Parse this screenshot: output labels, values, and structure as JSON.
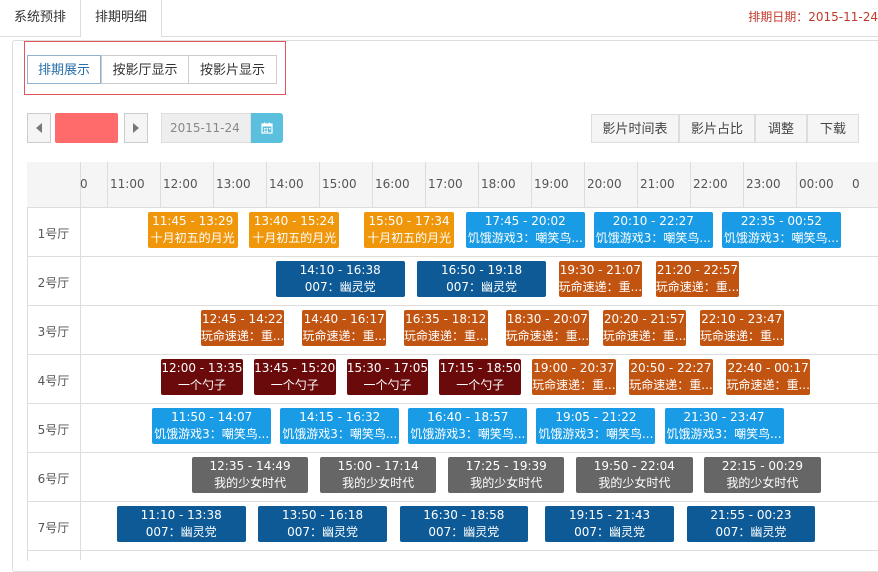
{
  "top_tabs": [
    {
      "label": "系统预排"
    },
    {
      "label": "排期明细"
    }
  ],
  "schedule_date_label": "排期日期：2015-11-24",
  "view_buttons": [
    {
      "label": "排期展示"
    },
    {
      "label": "按影厅显示"
    },
    {
      "label": "按影片显示"
    }
  ],
  "date_input": {
    "value": "2015-11-24"
  },
  "colors": {
    "accent_box": "#ff6b6b",
    "calendar_button": "#5bc0de",
    "date_label": "#c0392b"
  },
  "right_buttons": [
    {
      "label": "影片时间表"
    },
    {
      "label": "影片占比"
    },
    {
      "label": "调整"
    },
    {
      "label": "下载"
    }
  ],
  "time_labels": [
    "0",
    "11:00",
    "12:00",
    "13:00",
    "14:00",
    "15:00",
    "16:00",
    "17:00",
    "18:00",
    "19:00",
    "20:00",
    "21:00",
    "22:00",
    "23:00",
    "00:00",
    "0"
  ],
  "halls": [
    {
      "name": "1号厅",
      "shows": [
        {
          "time": "11:45 - 13:29",
          "title": "十月初五的月光",
          "color": "#f0960a"
        },
        {
          "time": "13:40 - 15:24",
          "title": "十月初五的月光",
          "color": "#f0960a"
        },
        {
          "time": "15:50 - 17:34",
          "title": "十月初五的月光",
          "color": "#f0960a"
        },
        {
          "time": "17:45 - 20:02",
          "title": "饥饿游戏3：嘲笑鸟...",
          "color": "#1a9be6"
        },
        {
          "time": "20:10 - 22:27",
          "title": "饥饿游戏3：嘲笑鸟...",
          "color": "#1a9be6"
        },
        {
          "time": "22:35 - 00:52",
          "title": "饥饿游戏3：嘲笑鸟...",
          "color": "#1a9be6"
        }
      ]
    },
    {
      "name": "2号厅",
      "shows": [
        {
          "time": "14:10 - 16:38",
          "title": "007：幽灵党",
          "color": "#0d5a96"
        },
        {
          "time": "16:50 - 19:18",
          "title": "007：幽灵党",
          "color": "#0d5a96"
        },
        {
          "time": "19:30 - 21:07",
          "title": "玩命速递：重...",
          "color": "#c25412"
        },
        {
          "time": "21:20 - 22:57",
          "title": "玩命速递：重...",
          "color": "#c25412"
        }
      ]
    },
    {
      "name": "3号厅",
      "shows": [
        {
          "time": "12:45 - 14:22",
          "title": "玩命速递：重...",
          "color": "#c25412"
        },
        {
          "time": "14:40 - 16:17",
          "title": "玩命速递：重...",
          "color": "#c25412"
        },
        {
          "time": "16:35 - 18:12",
          "title": "玩命速递：重...",
          "color": "#c25412"
        },
        {
          "time": "18:30 - 20:07",
          "title": "玩命速递：重...",
          "color": "#c25412"
        },
        {
          "time": "20:20 - 21:57",
          "title": "玩命速递：重...",
          "color": "#c25412"
        },
        {
          "time": "22:10 - 23:47",
          "title": "玩命速递：重...",
          "color": "#c25412"
        }
      ]
    },
    {
      "name": "4号厅",
      "shows": [
        {
          "time": "12:00 - 13:35",
          "title": "一个勺子",
          "color": "#6b0a0a"
        },
        {
          "time": "13:45 - 15:20",
          "title": "一个勺子",
          "color": "#6b0a0a"
        },
        {
          "time": "15:30 - 17:05",
          "title": "一个勺子",
          "color": "#6b0a0a"
        },
        {
          "time": "17:15 - 18:50",
          "title": "一个勺子",
          "color": "#6b0a0a"
        },
        {
          "time": "19:00 - 20:37",
          "title": "玩命速递：重...",
          "color": "#c25412"
        },
        {
          "time": "20:50 - 22:27",
          "title": "玩命速递：重...",
          "color": "#c25412"
        },
        {
          "time": "22:40 - 00:17",
          "title": "玩命速递：重...",
          "color": "#c25412"
        }
      ]
    },
    {
      "name": "5号厅",
      "shows": [
        {
          "time": "11:50 - 14:07",
          "title": "饥饿游戏3：嘲笑鸟...",
          "color": "#1a9be6"
        },
        {
          "time": "14:15 - 16:32",
          "title": "饥饿游戏3：嘲笑鸟...",
          "color": "#1a9be6"
        },
        {
          "time": "16:40 - 18:57",
          "title": "饥饿游戏3：嘲笑鸟...",
          "color": "#1a9be6"
        },
        {
          "time": "19:05 - 21:22",
          "title": "饥饿游戏3：嘲笑鸟...",
          "color": "#1a9be6"
        },
        {
          "time": "21:30 - 23:47",
          "title": "饥饿游戏3：嘲笑鸟...",
          "color": "#1a9be6"
        }
      ]
    },
    {
      "name": "6号厅",
      "shows": [
        {
          "time": "12:35 - 14:49",
          "title": "我的少女时代",
          "color": "#666666"
        },
        {
          "time": "15:00 - 17:14",
          "title": "我的少女时代",
          "color": "#666666"
        },
        {
          "time": "17:25 - 19:39",
          "title": "我的少女时代",
          "color": "#666666"
        },
        {
          "time": "19:50 - 22:04",
          "title": "我的少女时代",
          "color": "#666666"
        },
        {
          "time": "22:15 - 00:29",
          "title": "我的少女时代",
          "color": "#666666"
        }
      ]
    },
    {
      "name": "7号厅",
      "shows": [
        {
          "time": "11:10 - 13:38",
          "title": "007：幽灵党",
          "color": "#0d5a96"
        },
        {
          "time": "13:50 - 16:18",
          "title": "007：幽灵党",
          "color": "#0d5a96"
        },
        {
          "time": "16:30 - 18:58",
          "title": "007：幽灵党",
          "color": "#0d5a96"
        },
        {
          "time": "19:15 - 21:43",
          "title": "007：幽灵党",
          "color": "#0d5a96"
        },
        {
          "time": "21:55 - 00:23",
          "title": "007：幽灵党",
          "color": "#0d5a96"
        }
      ]
    }
  ]
}
